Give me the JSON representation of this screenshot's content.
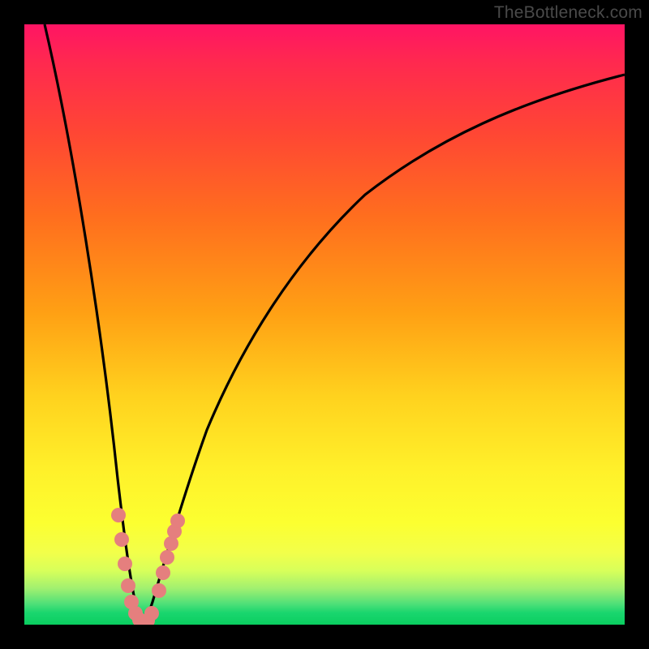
{
  "watermark": "TheBottleneck.com",
  "chart_data": {
    "type": "line",
    "title": "",
    "xlabel": "",
    "ylabel": "",
    "xlim": [
      0,
      100
    ],
    "ylim": [
      0,
      100
    ],
    "x": [
      0,
      5,
      8,
      11,
      13,
      14.5,
      16,
      17,
      18,
      19,
      20,
      22,
      24,
      27,
      30,
      35,
      40,
      48,
      56,
      65,
      75,
      85,
      95,
      100
    ],
    "values": [
      100,
      79,
      64,
      47,
      33,
      22,
      12,
      6,
      1,
      0,
      2,
      10,
      20,
      33,
      43,
      55,
      63,
      72,
      78,
      82.5,
      86,
      88.5,
      90.5,
      91.5
    ],
    "markers": {
      "x": [
        15.2,
        15.8,
        16.4,
        16.9,
        17.3,
        17.8,
        18.2,
        18.7,
        19.2,
        19.8,
        21.0,
        21.6,
        22.0,
        22.4,
        22.8,
        23.1
      ],
      "y": [
        17,
        13,
        9,
        6,
        4,
        2,
        1,
        0.5,
        0.5,
        1,
        5,
        8,
        10,
        12,
        14,
        16
      ],
      "color": "#e57f7e",
      "size": 9
    },
    "curve_color": "#000000",
    "background_gradient": {
      "top": "#ff1464",
      "mid1": "#ff6e1e",
      "mid2": "#fff02a",
      "bottom": "#0ace60"
    }
  }
}
